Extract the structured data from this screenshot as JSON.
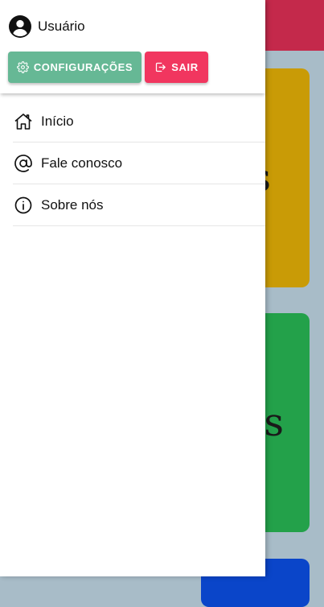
{
  "background": {
    "header_color": "#c4294b",
    "cards": [
      {
        "color": "#c99b06",
        "text_fragment": "s"
      },
      {
        "color": "#23a14a",
        "text_fragment": "os"
      },
      {
        "color": "#0a45c9",
        "text_fragment": ""
      }
    ]
  },
  "drawer": {
    "user": {
      "name": "Usuário",
      "icon": "account-circle-icon"
    },
    "buttons": {
      "settings": {
        "label": "CONFIGURAÇÕES",
        "icon": "gear-icon",
        "color": "#66b895"
      },
      "logout": {
        "label": "SAIR",
        "icon": "logout-icon",
        "color": "#f1365f"
      }
    },
    "menu": [
      {
        "label": "Início",
        "icon": "home-icon"
      },
      {
        "label": "Fale conosco",
        "icon": "at-icon"
      },
      {
        "label": "Sobre nós",
        "icon": "info-icon"
      }
    ]
  }
}
